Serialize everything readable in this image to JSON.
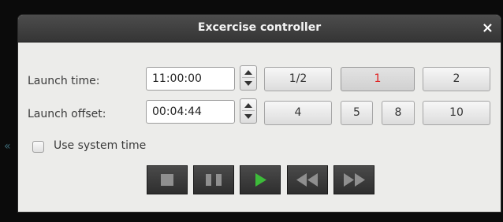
{
  "window": {
    "title": "Excercise controller",
    "close_glyph": "×"
  },
  "launch_time": {
    "label": "Launch time:",
    "value": "11:00:00"
  },
  "launch_offset": {
    "label": "Launch offset:",
    "value": "00:04:44"
  },
  "speed_buttons": {
    "half": "1/2",
    "one": "1",
    "two": "2",
    "four": "4",
    "five": "5",
    "eight": "8",
    "ten": "10",
    "active": "1",
    "active_color": "#e02020"
  },
  "system_time": {
    "label": "Use system time",
    "checked": false
  },
  "controls": {
    "icons": [
      "stop-icon",
      "pause-icon",
      "play-icon",
      "rewind-icon",
      "fast-forward-icon"
    ],
    "play_color": "#3dbb3a",
    "icon_color": "#8f8f8f"
  },
  "side_indicator": "«"
}
